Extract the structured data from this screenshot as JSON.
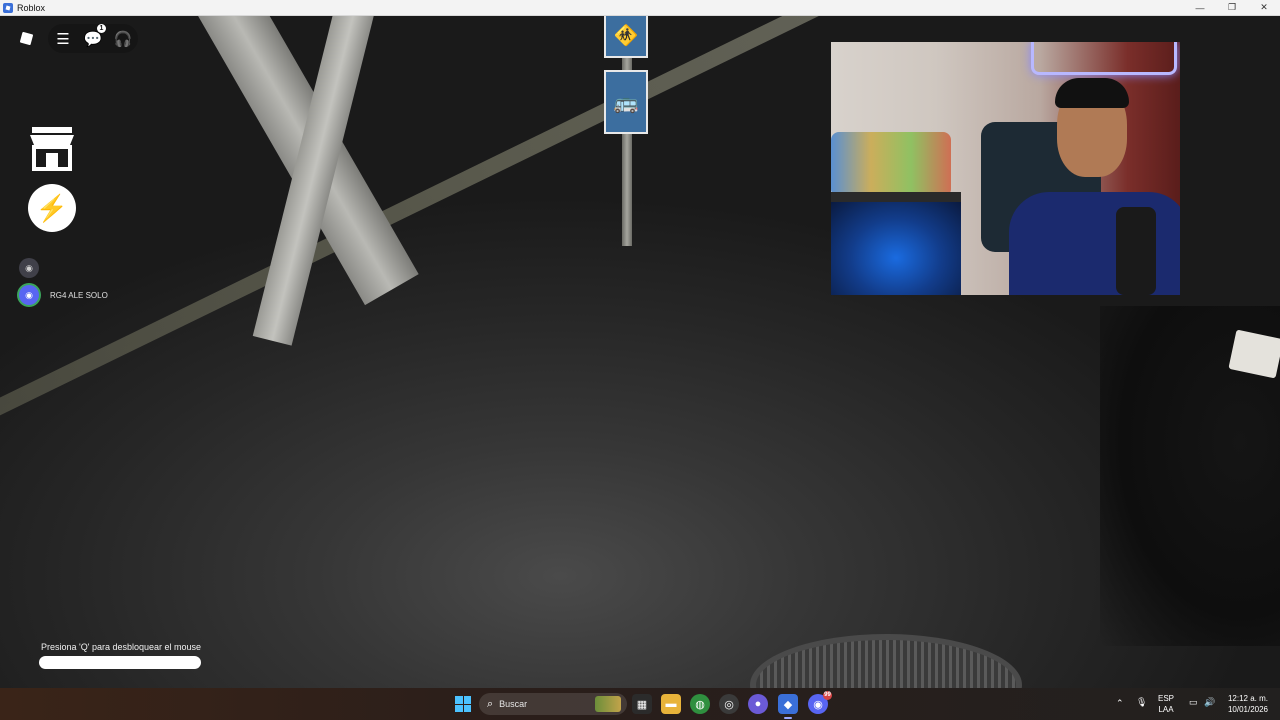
{
  "window": {
    "title": "Roblox",
    "minimize_icon": "minimize-icon",
    "maximize_icon": "restore-icon",
    "close_icon": "close-icon"
  },
  "hud": {
    "logo_icon": "roblox-logo-icon",
    "menu_icon": "hamburger-menu-icon",
    "chat_icon": "chat-icon",
    "chat_badge": "1",
    "voice_icon": "headset-icon",
    "shop_icon": "shop-icon",
    "boost_icon": "lightning-icon",
    "voice_users": [
      {
        "name": "",
        "icon": "discord-icon",
        "state": "muted"
      },
      {
        "name": "RG4 ALE SOLO",
        "icon": "discord-icon",
        "state": "speaking"
      }
    ],
    "hint": "Presiona 'Q' para desbloquear el mouse"
  },
  "webcam": {
    "label": ""
  },
  "taskbar": {
    "search_label": "Buscar",
    "apps": [
      {
        "name": "microsoft-store",
        "icon": "store-icon",
        "color": "#2b2b2b"
      },
      {
        "name": "file-explorer",
        "icon": "folder-icon",
        "color": "#e8b33a"
      },
      {
        "name": "chrome",
        "icon": "chrome-icon",
        "color": "#2f8f3f"
      },
      {
        "name": "obs-studio",
        "icon": "obs-icon",
        "color": "#3a3a3a"
      },
      {
        "name": "messenger",
        "icon": "chat-bubble-icon",
        "color": "#6b5ad6"
      },
      {
        "name": "roblox",
        "icon": "roblox-icon",
        "color": "#3a6fd8",
        "active": true
      },
      {
        "name": "discord",
        "icon": "discord-icon",
        "color": "#5865f2",
        "badge": "99"
      }
    ],
    "tray": {
      "chevron_icon": "chevron-up-icon",
      "mic_icon": "microphone-icon",
      "lang_top": "ESP",
      "lang_bottom": "LAA",
      "network_icon": "network-icon",
      "volume_icon": "volume-icon",
      "time": "12:12 a. m.",
      "date": "10/01/2026"
    }
  }
}
